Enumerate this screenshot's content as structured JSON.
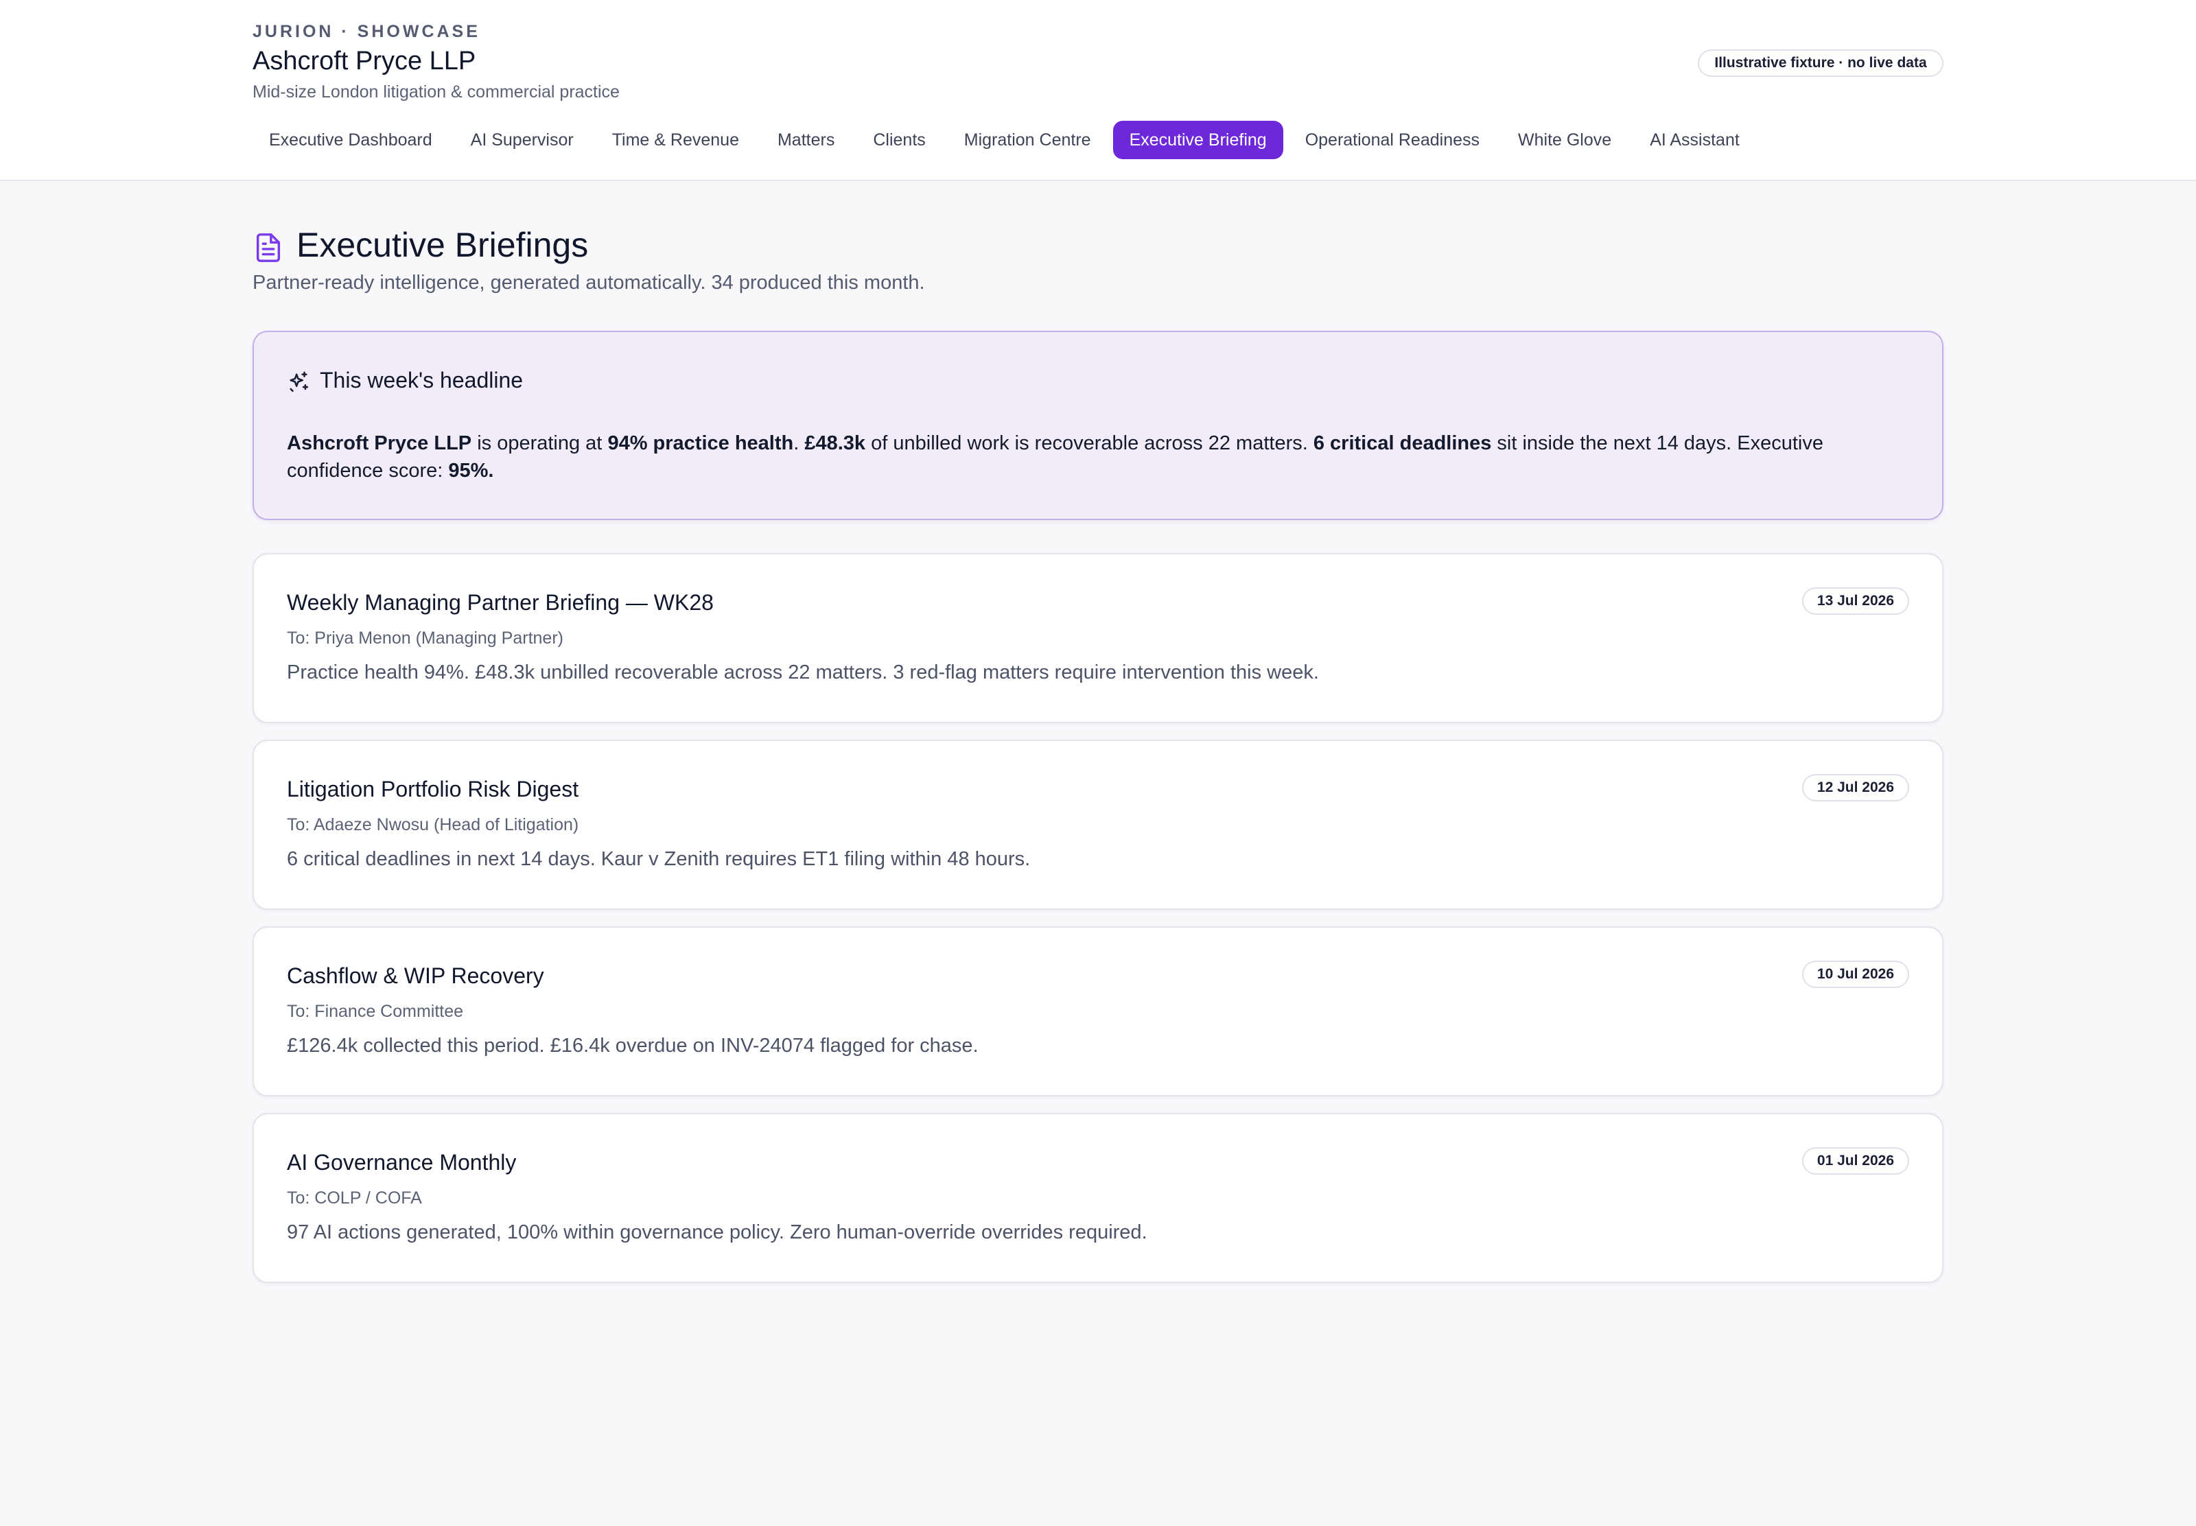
{
  "header": {
    "eyebrow": "JURION · SHOWCASE",
    "firm_name": "Ashcroft Pryce LLP",
    "firm_description": "Mid-size London litigation & commercial practice",
    "fixture_badge": "Illustrative fixture · no live data"
  },
  "nav": {
    "active_index": 6,
    "tabs": [
      {
        "label": "Executive Dashboard"
      },
      {
        "label": "AI Supervisor"
      },
      {
        "label": "Time & Revenue"
      },
      {
        "label": "Matters"
      },
      {
        "label": "Clients"
      },
      {
        "label": "Migration Centre"
      },
      {
        "label": "Executive Briefing"
      },
      {
        "label": "Operational Readiness"
      },
      {
        "label": "White Glove"
      },
      {
        "label": "AI Assistant"
      }
    ]
  },
  "page": {
    "icon": "document-icon",
    "title": "Executive Briefings",
    "subtitle": "Partner-ready intelligence, generated automatically. 34 produced this month."
  },
  "headline": {
    "icon": "sparkles-icon",
    "heading": "This week's headline",
    "firm": "Ashcroft Pryce LLP",
    "text_1": " is operating at ",
    "health": "94% practice health",
    "text_2": ". ",
    "unbilled": "£48.3k",
    "text_3": " of unbilled work is recoverable across 22 matters. ",
    "deadlines": "6 critical deadlines",
    "text_4": " sit inside the next 14 days. Executive confidence score: ",
    "confidence": "95%",
    "text_5": "."
  },
  "briefings": [
    {
      "title": "Weekly Managing Partner Briefing — WK28",
      "recipient": "To: Priya Menon (Managing Partner)",
      "summary": "Practice health 94%. £48.3k unbilled recoverable across 22 matters. 3 red-flag matters require intervention this week.",
      "date": "13 Jul 2026"
    },
    {
      "title": "Litigation Portfolio Risk Digest",
      "recipient": "To: Adaeze Nwosu (Head of Litigation)",
      "summary": "6 critical deadlines in next 14 days. Kaur v Zenith requires ET1 filing within 48 hours.",
      "date": "12 Jul 2026"
    },
    {
      "title": "Cashflow & WIP Recovery",
      "recipient": "To: Finance Committee",
      "summary": "£126.4k collected this period. £16.4k overdue on INV-24074 flagged for chase.",
      "date": "10 Jul 2026"
    },
    {
      "title": "AI Governance Monthly",
      "recipient": "To: COLP / COFA",
      "summary": "97 AI actions generated, 100% within governance policy. Zero human-override overrides required.",
      "date": "01 Jul 2026"
    }
  ],
  "colors": {
    "accent": "#6d28d9",
    "headline_bg": "#f1ecf8",
    "headline_border": "#c4aee9",
    "page_bg": "#f8f8fb"
  }
}
